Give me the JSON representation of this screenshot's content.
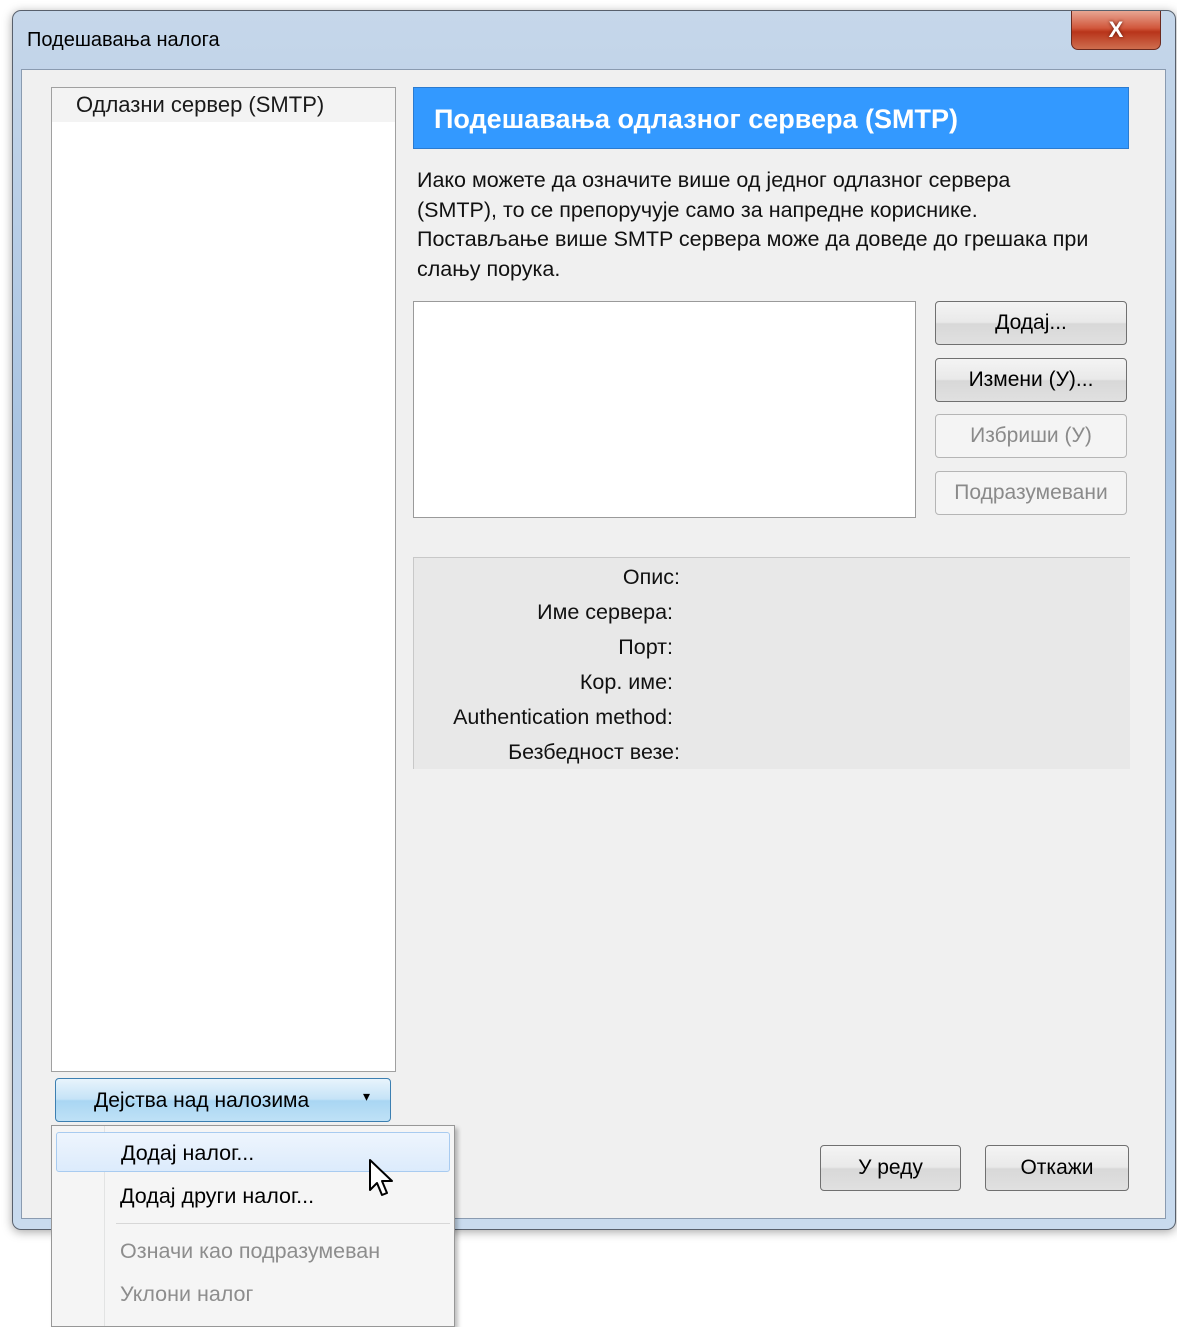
{
  "window": {
    "title": "Подешавања налога",
    "close_glyph": "X"
  },
  "sidebar": {
    "items": [
      {
        "label": "Одлазни сервер (SMTP)"
      }
    ],
    "actions_button": {
      "label": "Дејства над налозима",
      "arrow": "▾"
    }
  },
  "main": {
    "header": "Подешавања одлазног сервера (SMTP)",
    "description_lines": [
      "Иако можете да означите више од једног одлазног сервера",
      "(SMTP), то се препоручује само за напредне кориснике.",
      "Постављање више SMTP сервера може да доведе до грешака при",
      "слању порука."
    ],
    "buttons": {
      "add": {
        "label": "Додај...",
        "enabled": true
      },
      "edit": {
        "label": "Измени (У)...",
        "enabled": true
      },
      "delete": {
        "label": "Избриши (У)",
        "enabled": false
      },
      "default": {
        "label": "Подразумевани",
        "enabled": false
      }
    },
    "details": {
      "description_label": "Опис:",
      "server_name_label": "Име сервера:",
      "port_label": "Порт:",
      "username_label": "Кор. име:",
      "auth_label": "Authentication method:",
      "security_label": "Безбедност везе:"
    }
  },
  "footer": {
    "ok_label": "У реду",
    "cancel_label": "Откажи"
  },
  "menu": {
    "items": [
      {
        "label": "Додај налог...",
        "enabled": true,
        "highlighted": true
      },
      {
        "label": "Додај други налог...",
        "enabled": true,
        "highlighted": false
      },
      {
        "label": "Означи као подразумеван",
        "enabled": false,
        "highlighted": false
      },
      {
        "label": "Уклони налог",
        "enabled": false,
        "highlighted": false
      }
    ]
  },
  "colors": {
    "header_bg": "#3399ff",
    "header_text": "#ffffff",
    "close_btn": "#c8432a"
  },
  "icons": {
    "close": "close-icon",
    "dropdown": "chevron-down-icon",
    "cursor": "mouse-pointer-icon"
  }
}
